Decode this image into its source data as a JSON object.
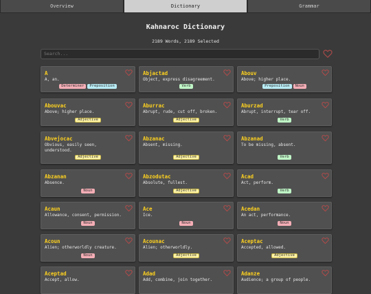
{
  "tabs": [
    {
      "label": "Overview",
      "active": false
    },
    {
      "label": "Dictionary",
      "active": true
    },
    {
      "label": "Grammar",
      "active": false
    }
  ],
  "title": "Kahnaroc Dictionary",
  "count": "2189 Words, 2189 Selected",
  "search": {
    "placeholder": "Search..."
  },
  "colors": {
    "accent": "#ffd21f",
    "heart": "#b84a4a",
    "card": "#505050",
    "background": "#3a3a3a"
  },
  "entries": [
    {
      "word": "A",
      "def": "A, an.",
      "tags": [
        "Determiner",
        "Preposition"
      ]
    },
    {
      "word": "Abjactad",
      "def": "Object, express disagreement.",
      "tags": [
        "Verb"
      ]
    },
    {
      "word": "Abouv",
      "def": "Above; higher place.",
      "tags": [
        "Preposition",
        "Noun"
      ]
    },
    {
      "word": "Abouvac",
      "def": "Above; higher place.",
      "tags": [
        "Adjective"
      ]
    },
    {
      "word": "Aburrac",
      "def": "Abrupt, rude, cut off, broken.",
      "tags": [
        "Adjective"
      ]
    },
    {
      "word": "Aburzad",
      "def": "Abrupt, interrupt, tear off.",
      "tags": [
        "Verb"
      ]
    },
    {
      "word": "Abvejocac",
      "def": "Obvious, easily seen, understood.",
      "tags": [
        "Adjective"
      ]
    },
    {
      "word": "Abzanac",
      "def": "Absent, missing.",
      "tags": [
        "Adjective"
      ]
    },
    {
      "word": "Abzanad",
      "def": "To be missing, absent.",
      "tags": [
        "Verb"
      ]
    },
    {
      "word": "Abzanan",
      "def": "Absence.",
      "tags": [
        "Noun"
      ]
    },
    {
      "word": "Abzodutac",
      "def": "Absolute, fullest.",
      "tags": [
        "Adjective"
      ]
    },
    {
      "word": "Acad",
      "def": "Act, perform.",
      "tags": [
        "Verb"
      ]
    },
    {
      "word": "Acaun",
      "def": "Allowance, consent, permission.",
      "tags": [
        "Noun"
      ]
    },
    {
      "word": "Ace",
      "def": "Ice.",
      "tags": [
        "Noun"
      ]
    },
    {
      "word": "Acedan",
      "def": "An act, performance.",
      "tags": [
        "Noun"
      ]
    },
    {
      "word": "Acoun",
      "def": "Alien; otherworldly creature.",
      "tags": [
        "Noun"
      ]
    },
    {
      "word": "Acounac",
      "def": "Alien; otherworldly.",
      "tags": [
        "Adjective"
      ]
    },
    {
      "word": "Aceptac",
      "def": "Accepted, allowed.",
      "tags": [
        "Adjective"
      ]
    },
    {
      "word": "Aceptad",
      "def": "Accept, allow.",
      "tags": []
    },
    {
      "word": "Adad",
      "def": "Add, combine, join together.",
      "tags": []
    },
    {
      "word": "Adanze",
      "def": "Audience; a group of people.",
      "tags": []
    }
  ]
}
